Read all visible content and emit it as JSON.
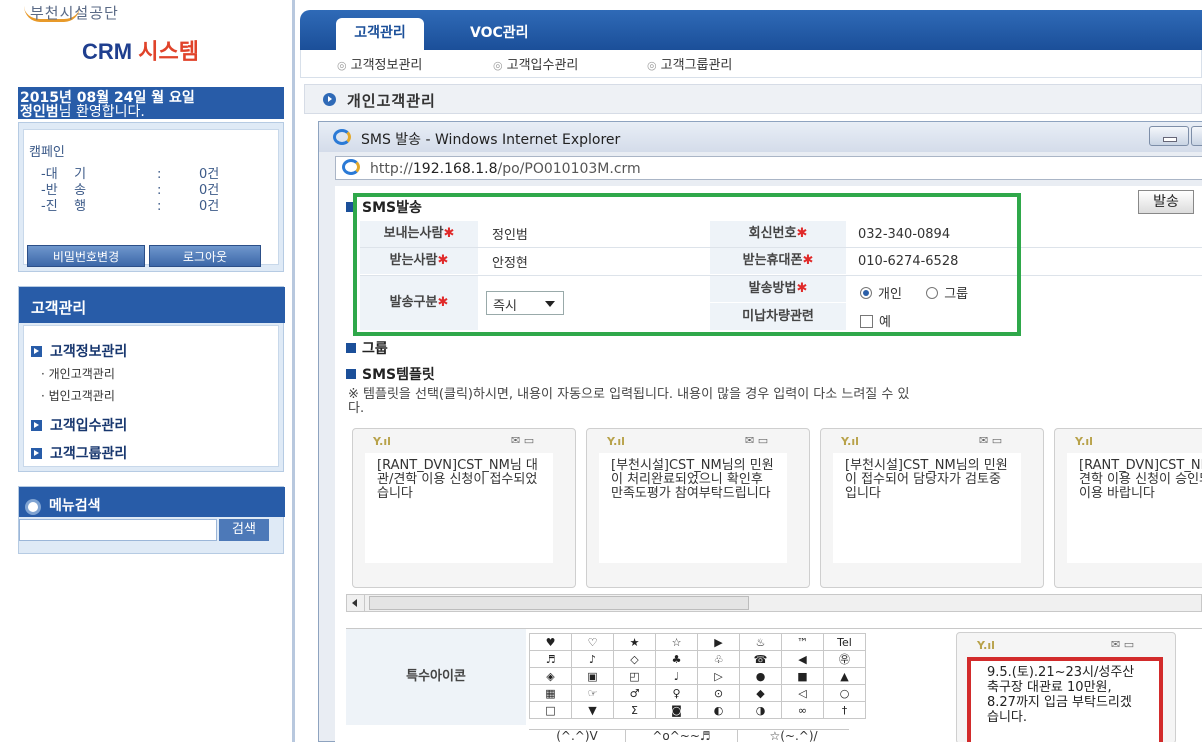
{
  "logo": {
    "subtitle": "부천시설공단",
    "title_main": "CRM",
    "title_accent": "시스템"
  },
  "sidebar": {
    "date": "2015년 08월 24일 월 요일",
    "greeting_name": "정인범",
    "greeting_suffix": "님 환영합니다.",
    "campaign": {
      "title": "캠페인",
      "rows": [
        {
          "label": "-대    기",
          "sep": ":",
          "value": "0건"
        },
        {
          "label": "-반    송",
          "sep": ":",
          "value": "0건"
        },
        {
          "label": "-진    행",
          "sep": ":",
          "value": "0건"
        }
      ]
    },
    "change_password": "비밀번호변경",
    "logout": "로그아웃",
    "menu_title": "고객관리",
    "menu": [
      {
        "label": "고객정보관리",
        "subs": [
          "개인고객관리",
          "법인고객관리"
        ]
      },
      {
        "label": "고객입수관리"
      },
      {
        "label": "고객그룹관리"
      }
    ],
    "menu_search_title": "메뉴검색",
    "search_button": "검색"
  },
  "topnav": {
    "tabs": [
      "고객관리",
      "VOC관리"
    ],
    "subitems": [
      "고객정보관리",
      "고객입수관리",
      "고객그룹관리"
    ]
  },
  "page_title": "개인고객관리",
  "ie": {
    "title": "SMS 발송 - Windows Internet Explorer",
    "url_prefix": "http://",
    "url_host": "192.168.1.8",
    "url_path": "/po/PO010103M.crm"
  },
  "sms": {
    "section_title": "SMS발송",
    "send_button": "발송",
    "sender_label": "보내는사람",
    "sender_value": "정인범",
    "reply_label": "회신번호",
    "reply_value": "032-340-0894",
    "receiver_label": "받는사람",
    "receiver_value": "안정현",
    "mobile_label": "받는휴대폰",
    "mobile_value": "010-6274-6528",
    "type_label": "발송구분",
    "type_value": "즉시",
    "method_label": "발송방법",
    "method_individual": "개인",
    "method_group": "그룹",
    "unpaid_label": "미납차량관련",
    "unpaid_check": "예",
    "required_mark": "✱"
  },
  "group_section": "그룹",
  "template_section": "SMS템플릿",
  "template_note": "※ 템플릿을 선택(클릭)하시면, 내용이 자동으로 입력됩니다. 내용이 많을 경우 입력이 다소 느려질 수 있",
  "template_note_2": "다.",
  "templates": [
    "[RANT_DVN]CST_NM님 대관/견학 이용 신청이 접수되었습니다",
    "[부천시설]CST_NM님의 민원이 처리완료되었으니 확인후 만족도평가 참여부탁드립니다",
    "[부천시설]CST_NM님의 민원이 접수되어 담당자가 검토중입니다",
    "[RANT_DVN]CST_NM님 대관/견학 이용 신청이 승인되었사오니 이용 바랍니다"
  ],
  "special_icon_label": "특수아이콘",
  "icons": [
    [
      "♥",
      "♡",
      "★",
      "☆",
      "▶",
      "♨",
      "™",
      "Tel"
    ],
    [
      "♬",
      "♪",
      "◇",
      "♣",
      "♧",
      "☎",
      "◀",
      "㉾"
    ],
    [
      "◈",
      "▣",
      "◰",
      "♩",
      "▷",
      "●",
      "■",
      "▲"
    ],
    [
      "▦",
      "☞",
      "♂",
      "♀",
      "⊙",
      "◆",
      "◁",
      "○"
    ],
    [
      "□",
      "▼",
      "Σ",
      "◙",
      "◐",
      "◑",
      "∞",
      "†"
    ]
  ],
  "emoticons": [
    "(^.^)V",
    "^o^~~♬",
    "☆(~.^)/"
  ],
  "phone_preview": "9.5.(토).21~23시/성주산축구장 대관료 10만원, 8.27까지 입금 부탁드리겠습니다."
}
